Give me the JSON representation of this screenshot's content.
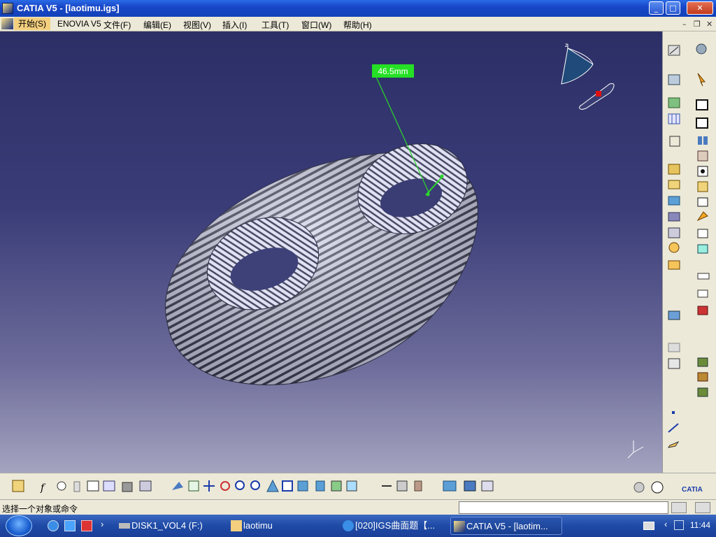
{
  "window": {
    "title": "CATIA V5 - [laotimu.igs]"
  },
  "menu": {
    "items": [
      "开始(S)",
      "ENOVIA V5",
      "文件(F)",
      "编辑(E)",
      "视图(V)",
      "插入(I)",
      "工具(T)",
      "窗口(W)",
      "帮助(H)"
    ]
  },
  "viewport": {
    "measurement_label": "46.5mm",
    "compass_label": "z"
  },
  "status": {
    "prompt": "选择一个对象或命令",
    "command_value": ""
  },
  "taskbar": {
    "items": [
      {
        "label": "DISK1_VOL4 (F:)",
        "icon": "drive-icon"
      },
      {
        "label": "laotimu",
        "icon": "folder-icon"
      },
      {
        "label": "[020]IGS曲面题【...",
        "icon": "ie-icon"
      },
      {
        "label": "CATIA V5 - [laotim...",
        "icon": "catia-icon"
      }
    ],
    "clock": "11:44"
  },
  "colors": {
    "titlebar": "#1847c8",
    "viewport_top": "#2c2f66",
    "viewport_bottom": "#a4a3bf",
    "measure_bg": "#25e025",
    "menu_active": "#f3cf7e"
  }
}
